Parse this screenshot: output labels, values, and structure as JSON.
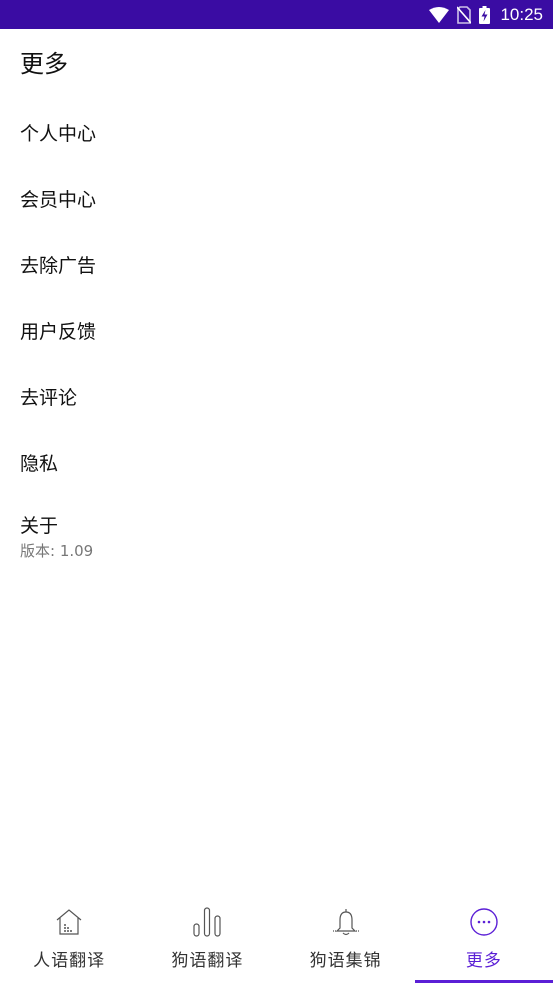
{
  "status_bar": {
    "time": "10:25",
    "icons": [
      "wifi-icon",
      "no-sim-icon",
      "battery-charging-icon"
    ],
    "background": "#3a0ca3"
  },
  "page": {
    "title": "更多"
  },
  "menu": {
    "items": [
      {
        "label": "个人中心"
      },
      {
        "label": "会员中心"
      },
      {
        "label": "去除广告"
      },
      {
        "label": "用户反馈"
      },
      {
        "label": "去评论"
      },
      {
        "label": "隐私"
      },
      {
        "label": "关于",
        "sub": "版本: 1.09"
      }
    ]
  },
  "bottom_nav": {
    "accent": "#5b1fd6",
    "items": [
      {
        "label": "人语翻译",
        "icon": "house-icon",
        "active": false
      },
      {
        "label": "狗语翻译",
        "icon": "bars-icon",
        "active": false
      },
      {
        "label": "狗语集锦",
        "icon": "bell-icon",
        "active": false
      },
      {
        "label": "更多",
        "icon": "more-circle-icon",
        "active": true
      }
    ]
  }
}
